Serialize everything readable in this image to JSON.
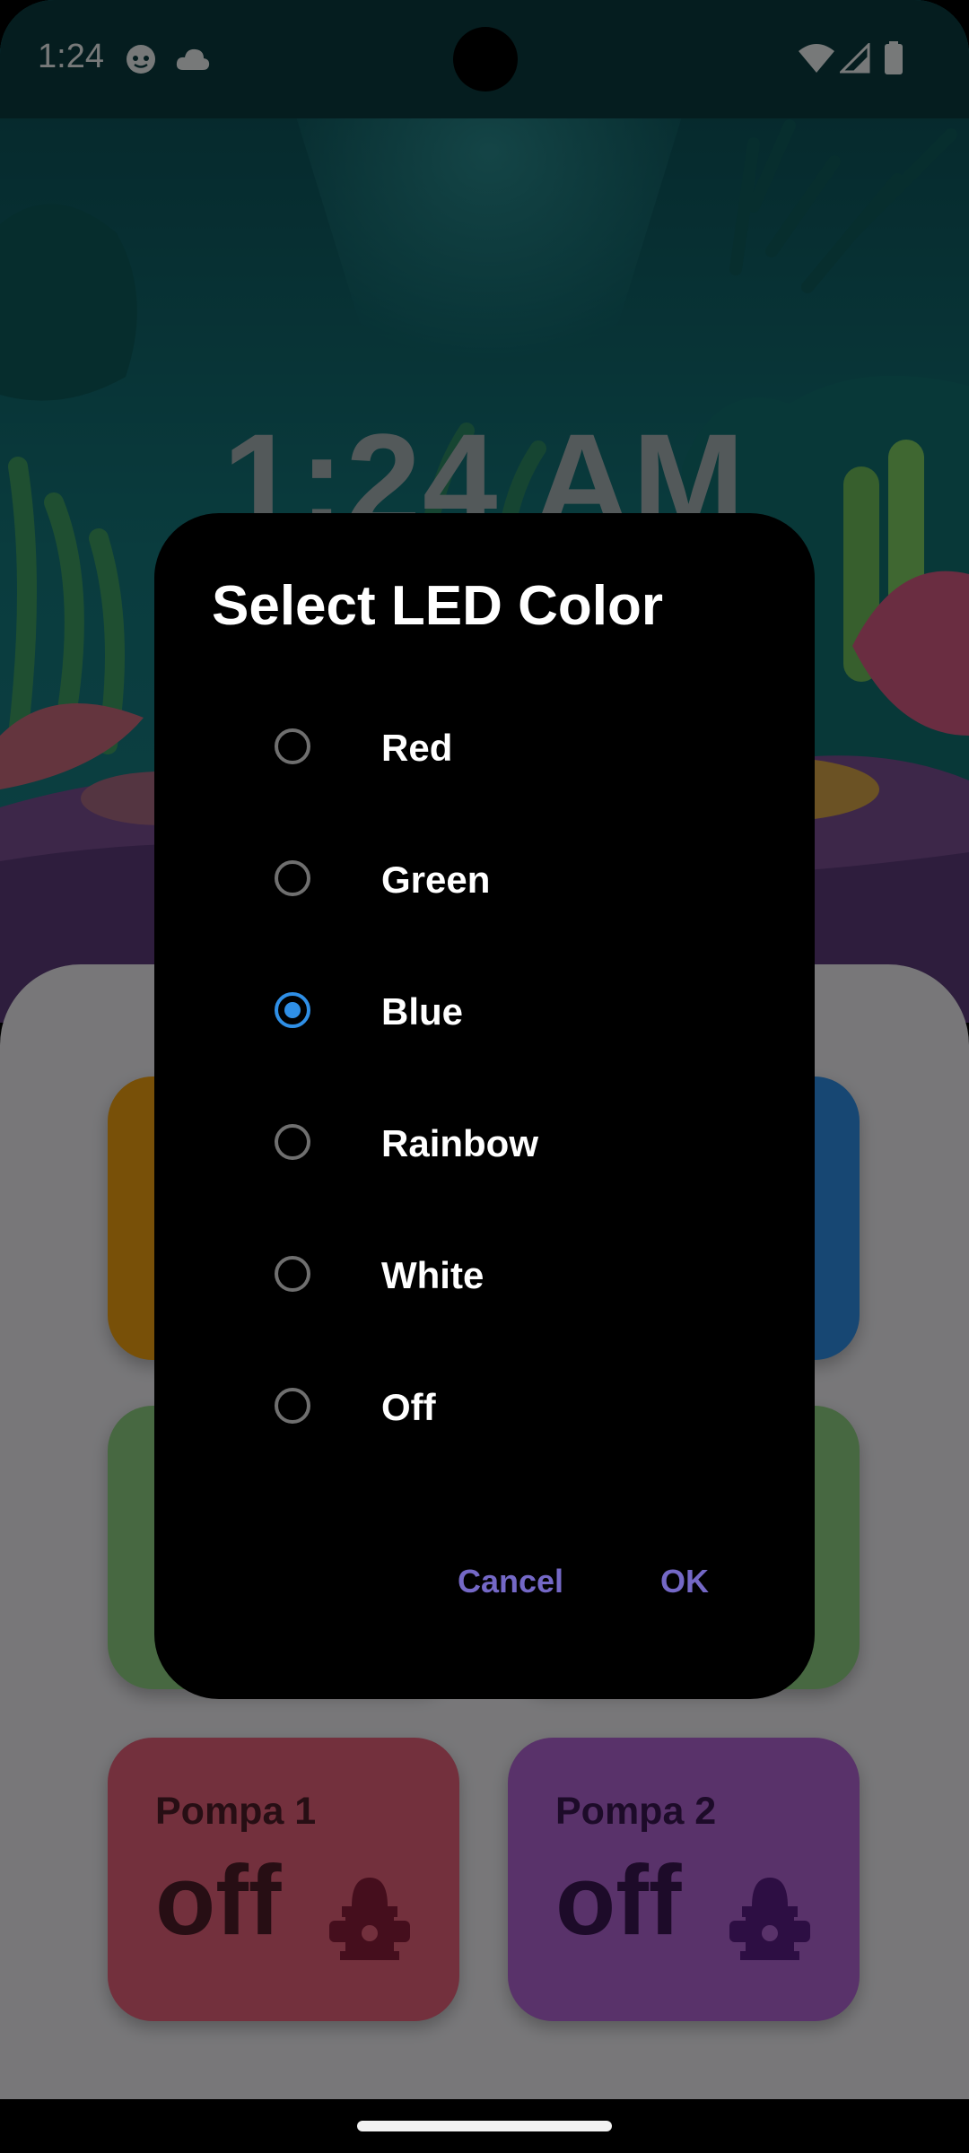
{
  "status_bar": {
    "time": "1:24",
    "left_icons": [
      "face-icon",
      "cloud-icon"
    ],
    "right_icons": [
      "wifi-icon",
      "signal-icon",
      "battery-icon"
    ]
  },
  "background": {
    "clock": "1:24 AM"
  },
  "tiles": [
    {
      "title": "Pompa 1",
      "value": "off",
      "icon": "hydrant-icon",
      "color": "#e6607a"
    },
    {
      "title": "Pompa 2",
      "value": "off",
      "icon": "hydrant-icon",
      "color": "#b365d4"
    }
  ],
  "tile_colors": {
    "orange": "#f0a010",
    "blue": "#2f8fe6",
    "green": "#8fd083"
  },
  "dialog": {
    "title": "Select LED Color",
    "options": [
      {
        "label": "Red",
        "selected": false
      },
      {
        "label": "Green",
        "selected": false
      },
      {
        "label": "Blue",
        "selected": true
      },
      {
        "label": "Rainbow",
        "selected": false
      },
      {
        "label": "White",
        "selected": false
      },
      {
        "label": "Off",
        "selected": false
      }
    ],
    "cancel_label": "Cancel",
    "ok_label": "OK"
  },
  "colors": {
    "accent": "#7468c6",
    "radio_selected": "#2f8fe6"
  }
}
